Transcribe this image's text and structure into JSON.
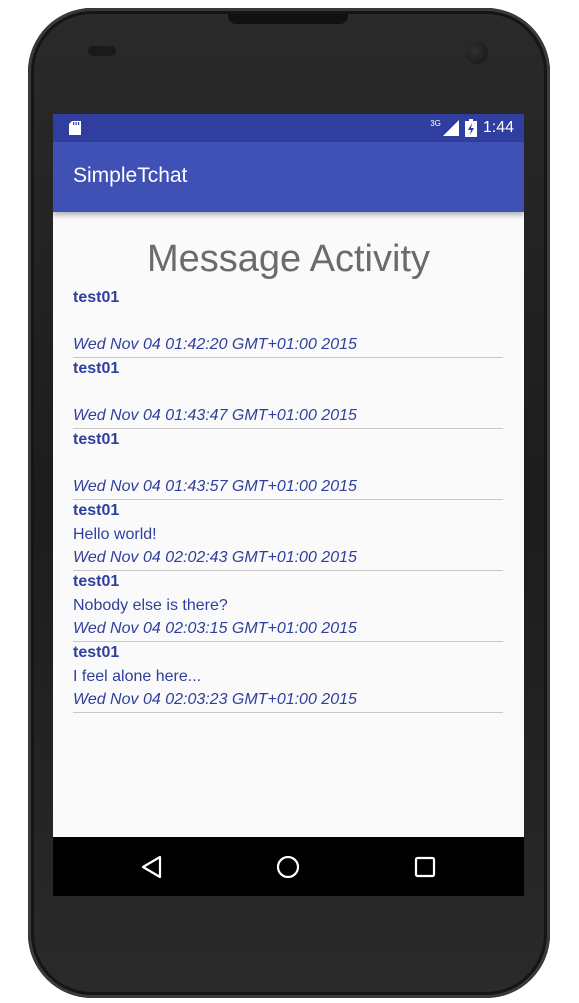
{
  "status_bar": {
    "network_type": "3G",
    "time": "1:44",
    "icons": [
      "sd-card-icon",
      "signal-icon",
      "battery-icon"
    ]
  },
  "app_bar": {
    "title": "SimpleTchat"
  },
  "page": {
    "heading": "Message Activity"
  },
  "messages": [
    {
      "user": "test01",
      "text": "",
      "date": "Wed Nov 04 01:42:20 GMT+01:00 2015"
    },
    {
      "user": "test01",
      "text": "",
      "date": "Wed Nov 04 01:43:47 GMT+01:00 2015"
    },
    {
      "user": "test01",
      "text": "",
      "date": "Wed Nov 04 01:43:57 GMT+01:00 2015"
    },
    {
      "user": "test01",
      "text": "Hello world!",
      "date": "Wed Nov 04 02:02:43 GMT+01:00 2015"
    },
    {
      "user": "test01",
      "text": "Nobody else is there?",
      "date": "Wed Nov 04 02:03:15 GMT+01:00 2015"
    },
    {
      "user": "test01",
      "text": "I feel alone here...",
      "date": "Wed Nov 04 02:03:23 GMT+01:00 2015"
    }
  ],
  "nav_bar": {
    "icons": [
      "back-icon",
      "home-icon",
      "recents-icon"
    ]
  },
  "colors": {
    "status_bar": "#303f9f",
    "app_bar": "#3f51b5",
    "message_text": "#2e3f9e",
    "heading_text": "#6b6b6b"
  }
}
